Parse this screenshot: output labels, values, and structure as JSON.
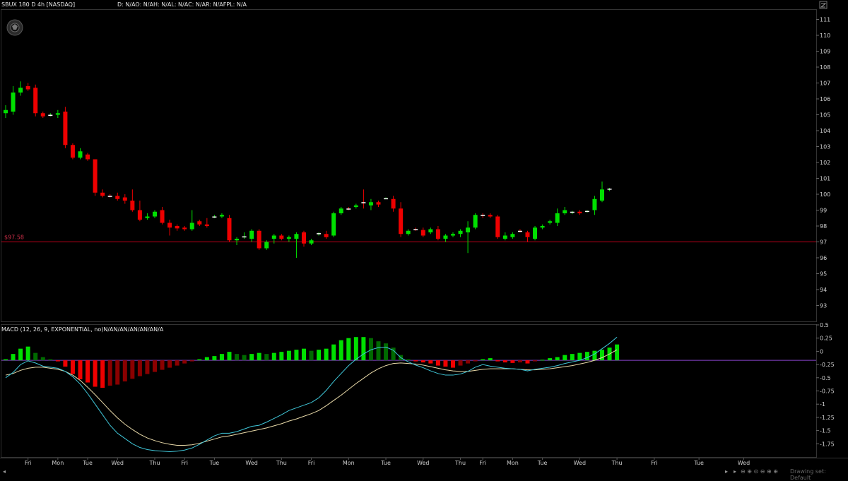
{
  "header": {
    "symbol_label": "SBUX 180 D 4h [NASDAQ]",
    "quote_label": "D: N/AO: N/AH: N/AL: N/AC: N/AR: N/AFPL: N/A"
  },
  "macd": {
    "label": "MACD (12, 26, 9, EXPONENTIAL, no)N/AN/AN/AN/AN/AN/A"
  },
  "footer": {
    "drawing_set": "Drawing set: Default"
  },
  "colors": {
    "up": "#00e000",
    "down": "#ee0000",
    "up_dim": "#006a00",
    "down_dim": "#8a0000",
    "macd_line": "#3fc6d8",
    "signal_line": "#e8d9a8",
    "zero_line": "#8844cc",
    "price_line": "#c0001a"
  },
  "chart_data": [
    {
      "type": "candlestick",
      "title": "SBUX 180 D 4h [NASDAQ]",
      "ylim": [
        92,
        111.6
      ],
      "y_ticks": [
        93,
        94,
        95,
        96,
        97,
        98,
        99,
        100,
        101,
        102,
        103,
        104,
        105,
        106,
        107,
        108,
        109,
        110,
        111
      ],
      "x_tick_labels": [
        {
          "label": "Fri",
          "i": 3
        },
        {
          "label": "Mon",
          "i": 7
        },
        {
          "label": "Tue",
          "i": 11
        },
        {
          "label": "Wed",
          "i": 15
        },
        {
          "label": "Thu",
          "i": 20
        },
        {
          "label": "Fri",
          "i": 24
        },
        {
          "label": "Tue",
          "i": 28
        },
        {
          "label": "Wed",
          "i": 33
        },
        {
          "label": "Thu",
          "i": 37
        },
        {
          "label": "Fri",
          "i": 41
        },
        {
          "label": "Mon",
          "i": 46
        },
        {
          "label": "Tue",
          "i": 51
        },
        {
          "label": "Wed",
          "i": 56
        },
        {
          "label": "Thu",
          "i": 61
        },
        {
          "label": "Fri",
          "i": 64
        },
        {
          "label": "Mon",
          "i": 68
        },
        {
          "label": "Tue",
          "i": 72
        },
        {
          "label": "Wed",
          "i": 77
        },
        {
          "label": "Thu",
          "i": 82
        },
        {
          "label": "Fri",
          "i": 87
        },
        {
          "label": "Tue",
          "i": 93
        },
        {
          "label": "Wed",
          "i": 99
        }
      ],
      "price_line": {
        "value": 97.0,
        "label": "$97.58"
      },
      "candles": [
        {
          "o": 105.1,
          "h": 105.6,
          "l": 104.8,
          "c": 105.3
        },
        {
          "o": 105.2,
          "h": 106.8,
          "l": 105.0,
          "c": 106.4
        },
        {
          "o": 106.4,
          "h": 107.1,
          "l": 106.2,
          "c": 106.7
        },
        {
          "o": 106.8,
          "h": 107.0,
          "l": 106.5,
          "c": 106.6
        },
        {
          "o": 106.7,
          "h": 106.9,
          "l": 104.9,
          "c": 105.1
        },
        {
          "o": 105.1,
          "h": 105.2,
          "l": 104.8,
          "c": 104.9
        },
        {
          "o": 105.0,
          "h": 105.1,
          "l": 104.9,
          "c": 105.0
        },
        {
          "o": 105.0,
          "h": 105.3,
          "l": 104.8,
          "c": 105.1
        },
        {
          "o": 105.2,
          "h": 105.5,
          "l": 102.9,
          "c": 103.1
        },
        {
          "o": 103.1,
          "h": 103.2,
          "l": 102.2,
          "c": 102.3
        },
        {
          "o": 102.3,
          "h": 102.9,
          "l": 102.2,
          "c": 102.7
        },
        {
          "o": 102.5,
          "h": 102.6,
          "l": 102.1,
          "c": 102.2
        },
        {
          "o": 102.2,
          "h": 102.2,
          "l": 99.9,
          "c": 100.1
        },
        {
          "o": 100.1,
          "h": 100.3,
          "l": 99.8,
          "c": 99.9
        },
        {
          "o": 99.9,
          "h": 100.0,
          "l": 99.8,
          "c": 99.85
        },
        {
          "o": 99.9,
          "h": 100.1,
          "l": 99.6,
          "c": 99.7
        },
        {
          "o": 99.8,
          "h": 100.0,
          "l": 99.4,
          "c": 99.6
        },
        {
          "o": 99.6,
          "h": 100.3,
          "l": 98.9,
          "c": 99.0
        },
        {
          "o": 99.0,
          "h": 99.6,
          "l": 98.3,
          "c": 98.4
        },
        {
          "o": 98.5,
          "h": 98.8,
          "l": 98.4,
          "c": 98.6
        },
        {
          "o": 98.6,
          "h": 99.0,
          "l": 98.5,
          "c": 98.9
        },
        {
          "o": 99.0,
          "h": 99.2,
          "l": 98.1,
          "c": 98.2
        },
        {
          "o": 98.2,
          "h": 98.4,
          "l": 97.4,
          "c": 97.9
        },
        {
          "o": 98.0,
          "h": 98.1,
          "l": 97.7,
          "c": 97.85
        },
        {
          "o": 97.9,
          "h": 98.0,
          "l": 97.7,
          "c": 97.8
        },
        {
          "o": 97.8,
          "h": 99.0,
          "l": 97.7,
          "c": 98.2
        },
        {
          "o": 98.3,
          "h": 98.4,
          "l": 98.0,
          "c": 98.1
        },
        {
          "o": 98.1,
          "h": 98.5,
          "l": 97.9,
          "c": 98.0
        },
        {
          "o": 98.6,
          "h": 98.7,
          "l": 98.5,
          "c": 98.6
        },
        {
          "o": 98.6,
          "h": 98.8,
          "l": 98.5,
          "c": 98.7
        },
        {
          "o": 98.5,
          "h": 98.7,
          "l": 97.0,
          "c": 97.1
        },
        {
          "o": 97.1,
          "h": 97.3,
          "l": 96.8,
          "c": 97.2
        },
        {
          "o": 97.3,
          "h": 97.6,
          "l": 97.2,
          "c": 97.35
        },
        {
          "o": 97.2,
          "h": 97.8,
          "l": 97.0,
          "c": 97.7
        },
        {
          "o": 97.7,
          "h": 97.8,
          "l": 96.5,
          "c": 96.6
        },
        {
          "o": 96.6,
          "h": 97.1,
          "l": 96.5,
          "c": 97.0
        },
        {
          "o": 97.2,
          "h": 97.5,
          "l": 96.9,
          "c": 97.4
        },
        {
          "o": 97.4,
          "h": 97.5,
          "l": 97.1,
          "c": 97.2
        },
        {
          "o": 97.2,
          "h": 97.4,
          "l": 97.0,
          "c": 97.3
        },
        {
          "o": 97.2,
          "h": 97.6,
          "l": 96.0,
          "c": 97.5
        },
        {
          "o": 97.6,
          "h": 97.7,
          "l": 96.7,
          "c": 96.9
        },
        {
          "o": 96.9,
          "h": 97.2,
          "l": 96.8,
          "c": 97.1
        },
        {
          "o": 97.5,
          "h": 97.6,
          "l": 97.4,
          "c": 97.55
        },
        {
          "o": 97.5,
          "h": 97.7,
          "l": 97.2,
          "c": 97.3
        },
        {
          "o": 97.4,
          "h": 98.9,
          "l": 97.3,
          "c": 98.8
        },
        {
          "o": 98.8,
          "h": 99.2,
          "l": 98.7,
          "c": 99.1
        },
        {
          "o": 99.1,
          "h": 99.2,
          "l": 99.0,
          "c": 99.05
        },
        {
          "o": 99.2,
          "h": 99.4,
          "l": 99.1,
          "c": 99.3
        },
        {
          "o": 99.5,
          "h": 100.3,
          "l": 99.1,
          "c": 99.45
        },
        {
          "o": 99.3,
          "h": 99.7,
          "l": 99.0,
          "c": 99.5
        },
        {
          "o": 99.5,
          "h": 99.6,
          "l": 99.2,
          "c": 99.35
        },
        {
          "o": 99.75,
          "h": 99.8,
          "l": 99.7,
          "c": 99.75
        },
        {
          "o": 99.7,
          "h": 99.9,
          "l": 98.9,
          "c": 99.1
        },
        {
          "o": 99.1,
          "h": 99.5,
          "l": 97.3,
          "c": 97.5
        },
        {
          "o": 97.5,
          "h": 97.8,
          "l": 97.4,
          "c": 97.7
        },
        {
          "o": 97.8,
          "h": 97.9,
          "l": 97.7,
          "c": 97.75
        },
        {
          "o": 97.75,
          "h": 97.9,
          "l": 97.3,
          "c": 97.4
        },
        {
          "o": 97.6,
          "h": 97.9,
          "l": 97.5,
          "c": 97.8
        },
        {
          "o": 97.8,
          "h": 98.0,
          "l": 97.1,
          "c": 97.2
        },
        {
          "o": 97.2,
          "h": 97.5,
          "l": 97.0,
          "c": 97.4
        },
        {
          "o": 97.4,
          "h": 97.6,
          "l": 97.3,
          "c": 97.5
        },
        {
          "o": 97.5,
          "h": 97.8,
          "l": 97.3,
          "c": 97.7
        },
        {
          "o": 97.6,
          "h": 98.3,
          "l": 96.3,
          "c": 97.9
        },
        {
          "o": 97.9,
          "h": 98.8,
          "l": 97.8,
          "c": 98.7
        },
        {
          "o": 98.7,
          "h": 98.8,
          "l": 98.5,
          "c": 98.65
        },
        {
          "o": 98.7,
          "h": 98.8,
          "l": 98.5,
          "c": 98.6
        },
        {
          "o": 98.6,
          "h": 98.7,
          "l": 97.2,
          "c": 97.3
        },
        {
          "o": 97.2,
          "h": 97.6,
          "l": 97.1,
          "c": 97.4
        },
        {
          "o": 97.3,
          "h": 97.6,
          "l": 97.2,
          "c": 97.5
        },
        {
          "o": 97.7,
          "h": 97.8,
          "l": 97.6,
          "c": 97.65
        },
        {
          "o": 97.6,
          "h": 97.7,
          "l": 97.0,
          "c": 97.3
        },
        {
          "o": 97.2,
          "h": 98.0,
          "l": 97.1,
          "c": 97.9
        },
        {
          "o": 97.9,
          "h": 98.1,
          "l": 97.8,
          "c": 98.0
        },
        {
          "o": 98.2,
          "h": 98.4,
          "l": 98.1,
          "c": 98.3
        },
        {
          "o": 98.2,
          "h": 99.1,
          "l": 98.0,
          "c": 98.8
        },
        {
          "o": 98.8,
          "h": 99.2,
          "l": 98.7,
          "c": 99.0
        },
        {
          "o": 98.85,
          "h": 98.95,
          "l": 98.75,
          "c": 98.9
        },
        {
          "o": 98.9,
          "h": 99.0,
          "l": 98.7,
          "c": 98.8
        },
        {
          "o": 98.9,
          "h": 99.0,
          "l": 98.85,
          "c": 98.95
        },
        {
          "o": 99.0,
          "h": 99.9,
          "l": 98.7,
          "c": 99.7
        },
        {
          "o": 99.6,
          "h": 100.8,
          "l": 99.5,
          "c": 100.3
        },
        {
          "o": 100.3,
          "h": 100.4,
          "l": 100.2,
          "c": 100.35
        }
      ]
    },
    {
      "type": "macd",
      "title": "MACD (12, 26, 9, EXPONENTIAL, no)N/AN/AN/AN/AN/AN/A",
      "ylim": [
        -2.0,
        0.5
      ],
      "y_ticks": [
        -1.75,
        -1.5,
        -1.25,
        -1,
        -0.75,
        -0.5,
        -0.25,
        0,
        0.25,
        0.5
      ],
      "x_tick_labels": [
        "Fri",
        "Mon",
        "Tue",
        "Wed",
        "Thu",
        "Fri",
        "Tue",
        "Wed",
        "Thu",
        "Fri",
        "Mon",
        "Tue",
        "Wed",
        "Thu",
        "Fri",
        "Mon",
        "Tue",
        "Wed",
        "Thu",
        "Fri",
        "Tue",
        "Wed"
      ],
      "hist": [
        0.02,
        0.12,
        0.22,
        0.26,
        0.14,
        0.06,
        0.02,
        -0.02,
        -0.12,
        -0.26,
        -0.36,
        -0.42,
        -0.5,
        -0.52,
        -0.48,
        -0.46,
        -0.4,
        -0.35,
        -0.3,
        -0.26,
        -0.22,
        -0.18,
        -0.14,
        -0.1,
        -0.06,
        -0.02,
        0.02,
        0.06,
        0.08,
        0.12,
        0.16,
        0.12,
        0.1,
        0.12,
        0.14,
        0.12,
        0.14,
        0.16,
        0.18,
        0.2,
        0.22,
        0.18,
        0.2,
        0.22,
        0.3,
        0.38,
        0.42,
        0.44,
        0.44,
        0.42,
        0.36,
        0.32,
        0.24,
        0.1,
        0.02,
        -0.02,
        -0.04,
        -0.06,
        -0.1,
        -0.12,
        -0.14,
        -0.1,
        -0.06,
        -0.02,
        0.02,
        0.04,
        -0.02,
        -0.04,
        -0.05,
        -0.04,
        -0.06,
        -0.02,
        0.01,
        0.04,
        0.06,
        0.1,
        0.12,
        0.14,
        0.16,
        0.18,
        0.2,
        0.24,
        0.3
      ],
      "macd_line": [
        -0.5,
        -0.4,
        -0.25,
        -0.18,
        -0.22,
        -0.28,
        -0.3,
        -0.32,
        -0.38,
        -0.48,
        -0.62,
        -0.8,
        -1.0,
        -1.2,
        -1.4,
        -1.55,
        -1.65,
        -1.75,
        -1.82,
        -1.86,
        -1.88,
        -1.89,
        -1.9,
        -1.89,
        -1.87,
        -1.83,
        -1.76,
        -1.68,
        -1.6,
        -1.55,
        -1.55,
        -1.52,
        -1.47,
        -1.42,
        -1.4,
        -1.34,
        -1.27,
        -1.2,
        -1.12,
        -1.07,
        -1.02,
        -0.97,
        -0.88,
        -0.74,
        -0.57,
        -0.42,
        -0.27,
        -0.15,
        -0.05,
        0.03,
        0.07,
        0.08,
        0.02,
        -0.12,
        -0.2,
        -0.26,
        -0.31,
        -0.37,
        -0.42,
        -0.45,
        -0.45,
        -0.43,
        -0.38,
        -0.3,
        -0.25,
        -0.28,
        -0.3,
        -0.32,
        -0.33,
        -0.34,
        -0.37,
        -0.34,
        -0.32,
        -0.3,
        -0.27,
        -0.23,
        -0.2,
        -0.17,
        -0.12,
        -0.05,
        0.05,
        0.15,
        0.27
      ],
      "signal_line": [
        -0.45,
        -0.42,
        -0.36,
        -0.32,
        -0.3,
        -0.3,
        -0.32,
        -0.34,
        -0.38,
        -0.45,
        -0.55,
        -0.68,
        -0.82,
        -0.97,
        -1.12,
        -1.26,
        -1.38,
        -1.48,
        -1.57,
        -1.64,
        -1.69,
        -1.73,
        -1.76,
        -1.78,
        -1.78,
        -1.77,
        -1.74,
        -1.7,
        -1.66,
        -1.62,
        -1.6,
        -1.57,
        -1.54,
        -1.51,
        -1.48,
        -1.45,
        -1.41,
        -1.37,
        -1.32,
        -1.28,
        -1.23,
        -1.18,
        -1.12,
        -1.03,
        -0.93,
        -0.83,
        -0.72,
        -0.61,
        -0.51,
        -0.41,
        -0.33,
        -0.27,
        -0.23,
        -0.22,
        -0.23,
        -0.24,
        -0.26,
        -0.29,
        -0.32,
        -0.35,
        -0.37,
        -0.38,
        -0.38,
        -0.36,
        -0.34,
        -0.33,
        -0.33,
        -0.33,
        -0.33,
        -0.34,
        -0.35,
        -0.35,
        -0.34,
        -0.33,
        -0.31,
        -0.29,
        -0.27,
        -0.24,
        -0.21,
        -0.17,
        -0.12,
        -0.05,
        0.03
      ]
    }
  ]
}
